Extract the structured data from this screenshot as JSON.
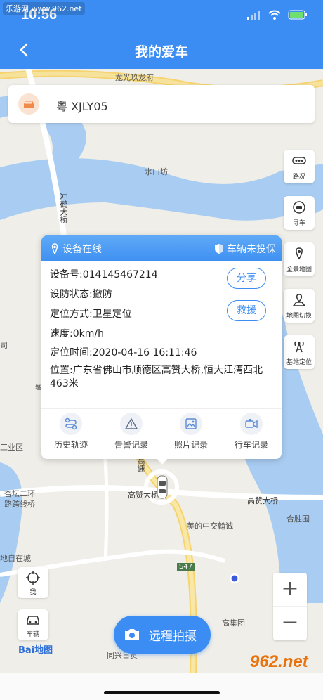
{
  "status_bar": {
    "time": "10:56",
    "watermark": "乐游网 www.962.net"
  },
  "nav": {
    "title": "我的爱车"
  },
  "vehicle": {
    "plate": "粤 XJLY05"
  },
  "map_labels": {
    "l1": "龙光玖龙府",
    "l2": "水口坊",
    "l3": "冲鹤大桥",
    "l4": "工业区",
    "l5": "杏坛二环",
    "l6": "路跨线桥",
    "l7": "高赞大桥",
    "l8": "高赞大桥",
    "l9": "合胜围",
    "l10": "美的中交翰诚",
    "l11": "S47",
    "l12": "地自在城",
    "l13": "高集团",
    "l14": "同兴日货",
    "l15": "高速",
    "l16": "智",
    "l17": "司"
  },
  "tools": [
    {
      "label": "路况",
      "icon": "traffic-icon"
    },
    {
      "label": "寻车",
      "icon": "find-car-icon"
    },
    {
      "label": "全景地图",
      "icon": "panorama-icon"
    },
    {
      "label": "地图切换",
      "icon": "map-switch-icon"
    },
    {
      "label": "基站定位",
      "icon": "base-station-icon"
    }
  ],
  "card": {
    "online": "设备在线",
    "insurance": "车辆未投保",
    "device_no": "设备号:014145467214",
    "defense": "设防状态:撤防",
    "locate_mode": "定位方式:卫星定位",
    "speed": "速度:0km/h",
    "locate_time": "定位时间:2020-04-16 16:11:46",
    "address": "位置:广东省佛山市顺德区高赞大桥,恒大江湾西北463米",
    "share": "分享",
    "rescue": "救援",
    "actions": [
      {
        "label": "历史轨迹",
        "icon": "track-icon"
      },
      {
        "label": "告警记录",
        "icon": "alert-icon"
      },
      {
        "label": "照片记录",
        "icon": "photo-icon"
      },
      {
        "label": "行车记录",
        "icon": "video-icon"
      }
    ]
  },
  "left_buttons": {
    "me": "我",
    "car": "车辆"
  },
  "baidu": "Bai地图",
  "zoom": {
    "in": "+",
    "out": "−"
  },
  "capture": {
    "label": "远程拍摄"
  },
  "watermark": "962.net"
}
